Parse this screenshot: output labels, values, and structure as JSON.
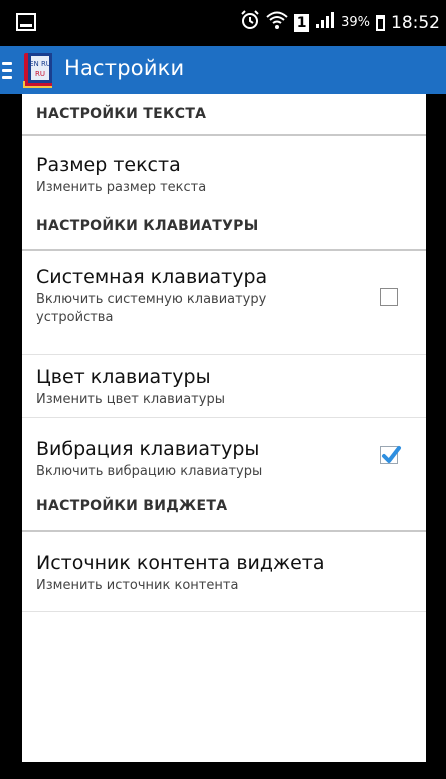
{
  "status_bar": {
    "battery_percent": "39%",
    "time": "18:52",
    "sim_slot": "1"
  },
  "app_bar": {
    "title": "Настройки",
    "logo_text": "EN RU"
  },
  "sections": [
    {
      "label": "НАСТРОЙКИ ТЕКСТА"
    },
    {
      "label": "НАСТРОЙКИ КЛАВИАТУРЫ"
    },
    {
      "label": "НАСТРОЙКИ ВИДЖЕТА"
    }
  ],
  "prefs": {
    "text_size": {
      "title": "Размер текста",
      "summary": "Изменить размер текста"
    },
    "system_keyboard": {
      "title": "Системная клавиатура",
      "summary": "Включить системную клавиатуру устройства",
      "checked": false
    },
    "keyboard_color": {
      "title": "Цвет клавиатуры",
      "summary": "Изменить цвет клавиатуры"
    },
    "keyboard_vibration": {
      "title": "Вибрация клавиатуры",
      "summary": "Включить вибрацию клавиатуры",
      "checked": true
    },
    "widget_source": {
      "title": "Источник контента виджета",
      "summary": "Изменить источник контента"
    }
  },
  "colors": {
    "app_bar": "#1e6fc4",
    "check_accent": "#2f8fe0"
  },
  "icons": [
    "gallery-icon",
    "alarm-icon",
    "wifi-icon",
    "signal-icon",
    "battery-icon",
    "menu-icon",
    "app-logo-icon",
    "checkmark-icon"
  ]
}
